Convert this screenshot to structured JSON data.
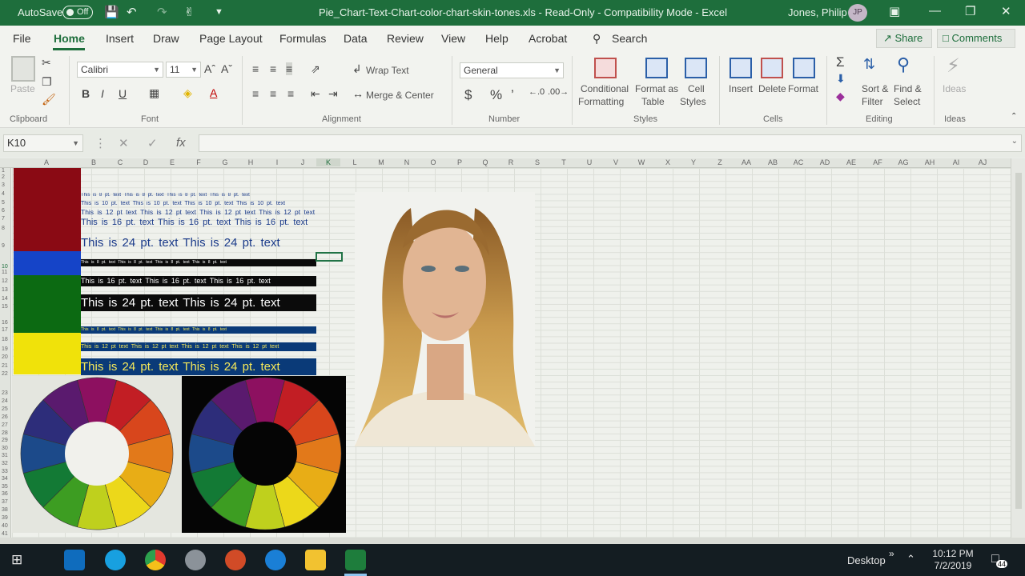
{
  "titlebar": {
    "autosave_label": "AutoSave",
    "autosave_state": "Off",
    "document_title": "Pie_Chart-Text-Chart-color-chart-skin-tones.xls  -  Read-Only  -  Compatibility Mode  -  Excel",
    "user_name": "Jones, Philip",
    "user_initials": "JP"
  },
  "ribbon_tabs": [
    "File",
    "Home",
    "Insert",
    "Draw",
    "Page Layout",
    "Formulas",
    "Data",
    "Review",
    "View",
    "Help",
    "Acrobat"
  ],
  "active_tab": "Home",
  "search_label": "Search",
  "share_label": "Share",
  "comments_label": "Comments",
  "ribbon": {
    "clipboard": {
      "paste": "Paste",
      "group": "Clipboard"
    },
    "font": {
      "family": "Calibri",
      "size": "11",
      "group": "Font",
      "bold": "B",
      "italic": "I",
      "underline": "U"
    },
    "alignment": {
      "wrap_text": "Wrap Text",
      "merge_center": "Merge & Center",
      "group": "Alignment"
    },
    "number": {
      "format": "General",
      "group": "Number",
      "currency": "$",
      "percent": "%"
    },
    "styles": {
      "conditional_formatting_1": "Conditional",
      "conditional_formatting_2": "Formatting",
      "format_as_table_1": "Format as",
      "format_as_table_2": "Table",
      "cell_styles_1": "Cell",
      "cell_styles_2": "Styles",
      "group": "Styles"
    },
    "cells": {
      "insert": "Insert",
      "delete": "Delete",
      "format": "Format",
      "group": "Cells"
    },
    "editing": {
      "sort_filter_1": "Sort &",
      "sort_filter_2": "Filter",
      "find_select_1": "Find &",
      "find_select_2": "Select",
      "group": "Editing"
    },
    "ideas": {
      "label": "Ideas",
      "group": "Ideas"
    }
  },
  "formula_bar": {
    "name_box": "K10",
    "fx": "fx",
    "value": ""
  },
  "columns": [
    "A",
    "B",
    "C",
    "D",
    "E",
    "F",
    "G",
    "H",
    "I",
    "J",
    "K",
    "L",
    "M",
    "N",
    "O",
    "P",
    "Q",
    "R",
    "S",
    "T",
    "U",
    "V",
    "W",
    "X",
    "Y",
    "Z",
    "AA",
    "AB",
    "AC",
    "AD",
    "AE",
    "AF",
    "AG",
    "AH",
    "AI",
    "AJ"
  ],
  "rows": [
    "1",
    "2",
    "3",
    "4",
    "5",
    "6",
    "7",
    "8",
    "9",
    "10",
    "11",
    "12",
    "13",
    "14",
    "15",
    "16",
    "17",
    "18",
    "19",
    "20",
    "21",
    "22",
    "23",
    "24",
    "25",
    "26",
    "27",
    "28",
    "29",
    "30",
    "31",
    "32",
    "33",
    "34",
    "35",
    "36",
    "37",
    "38",
    "39",
    "40",
    "41"
  ],
  "text_samples": {
    "pt8": "This is 8 pt. text  This is 8 pt. text  This is 8 pt. text  This is 8 pt. text",
    "pt10": "This is 10 pt. text  This is 10 pt. text  This is 10 pt. text  This is 10 pt. text",
    "pt12": "This is 12 pt text  This is 12 pt text  This is 12 pt text  This is 12 pt text",
    "pt16": "This is 16 pt. text  This is 16 pt. text  This is 16 pt. text",
    "pt24": "This is 24 pt. text  This is 24 pt. text"
  },
  "colors": {
    "red_swatch": "#8a0a14",
    "blue_swatch": "#1544c8",
    "green_swatch": "#0c6a12",
    "yellow_swatch": "#f0e20a",
    "excel_green": "#1e6e3c",
    "navy_row": "#0a3a78"
  },
  "taskbar": {
    "desktop_label": "Desktop",
    "time": "10:12 PM",
    "date": "7/2/2019",
    "notification_count": "44"
  }
}
